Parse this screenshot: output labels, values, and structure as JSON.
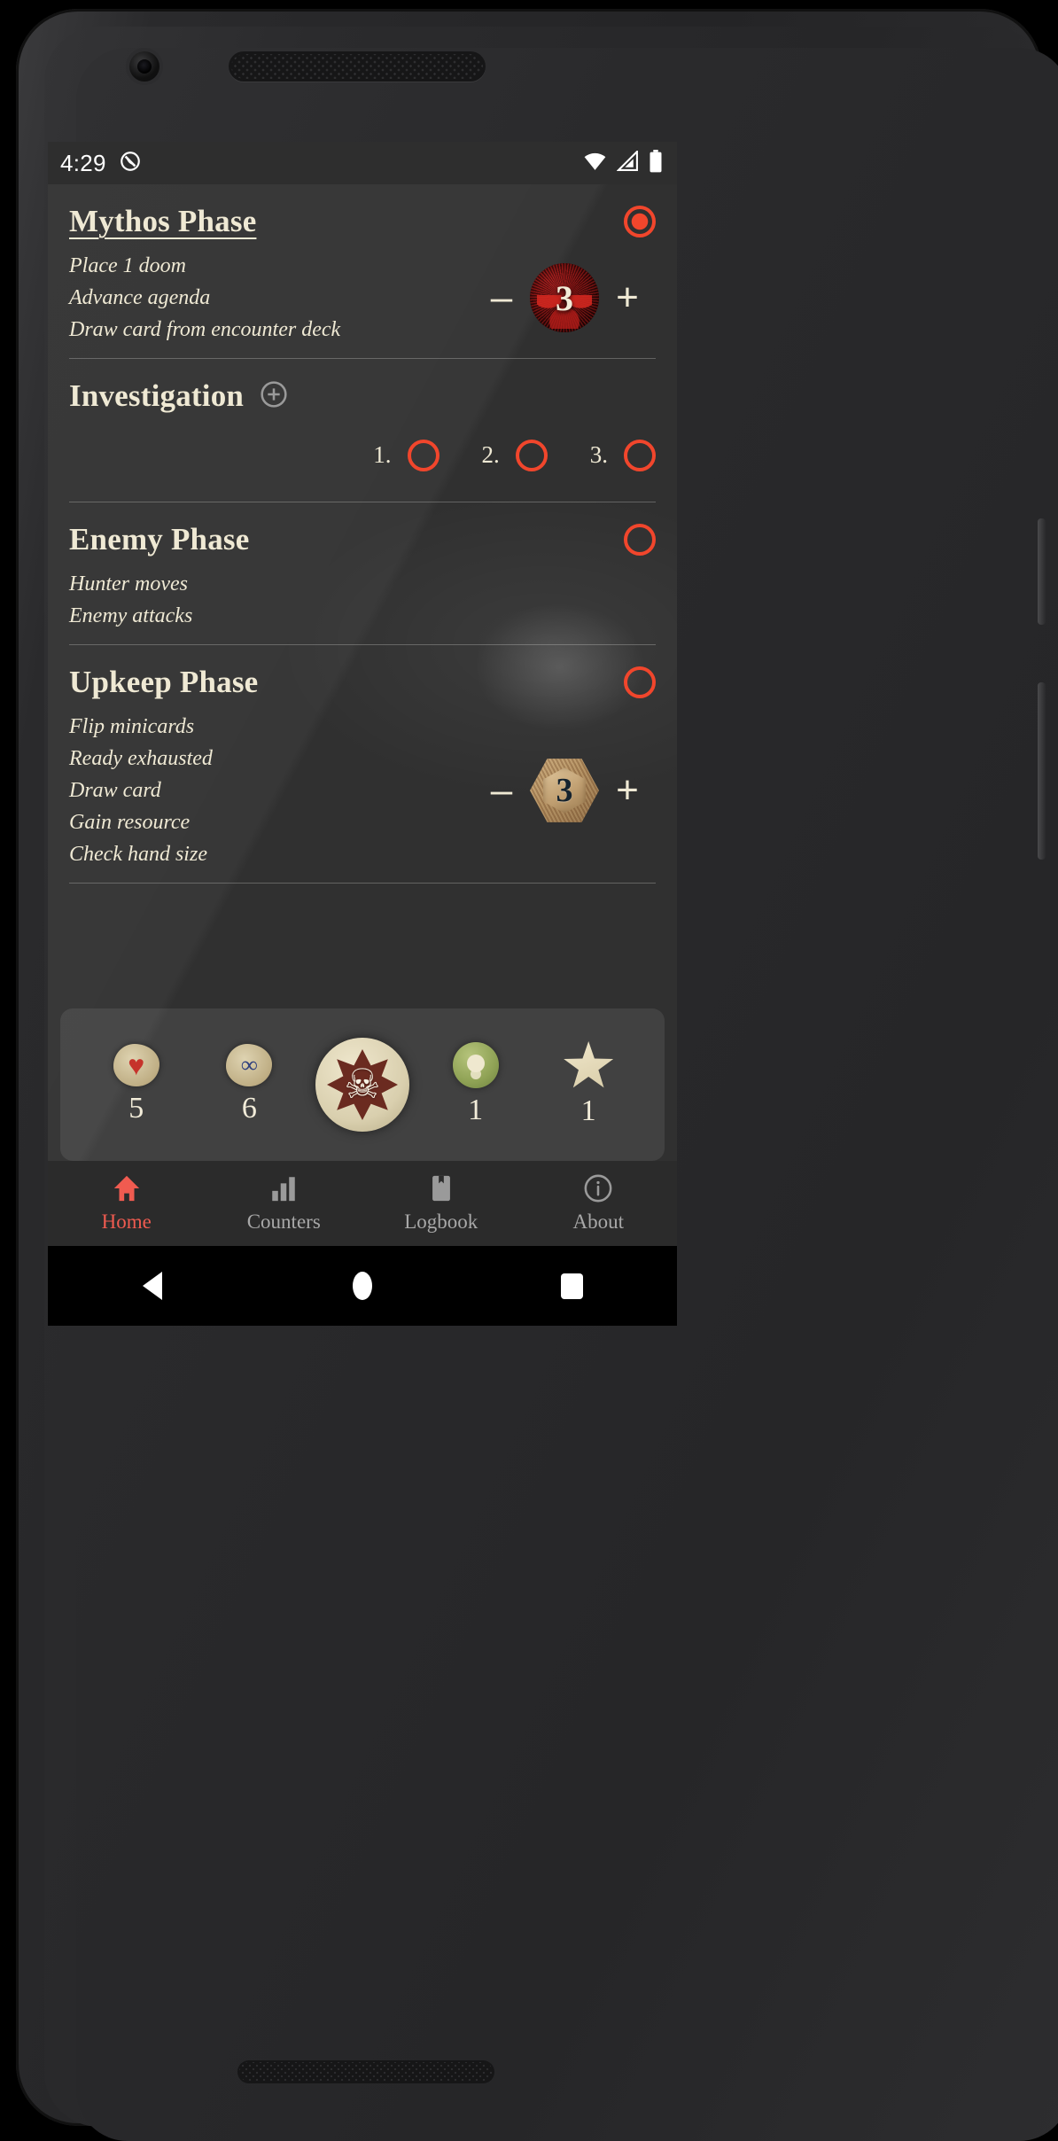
{
  "status_bar": {
    "time": "4:29",
    "icons": [
      "do-not-disturb-icon",
      "wifi-icon",
      "cellular-signal-icon",
      "battery-icon"
    ]
  },
  "colors": {
    "accent_red": "#f1462c",
    "nav_active": "#f05b50",
    "parchment": "#efe9d4",
    "screen_bg": "#303030",
    "tray_bg": "rgba(255,255,255,0.085)"
  },
  "phases": [
    {
      "title": "Mythos Phase",
      "underlined": true,
      "selected": true,
      "bullets": [
        "Place 1 doom",
        "Advance agenda",
        "Draw card from encounter deck"
      ],
      "counter": {
        "type": "doom-token",
        "value": "3",
        "decrement_label": "–",
        "increment_label": "+"
      }
    },
    {
      "title": "Enemy Phase",
      "underlined": false,
      "selected": false,
      "bullets": [
        "Hunter moves",
        "Enemy attacks"
      ],
      "counter": null
    },
    {
      "title": "Upkeep Phase",
      "underlined": false,
      "selected": false,
      "bullets": [
        "Flip minicards",
        "Ready exhausted",
        "Draw card",
        "Gain resource",
        "Check hand size"
      ],
      "counter": {
        "type": "resource-token",
        "value": "3",
        "decrement_label": "–",
        "increment_label": "+"
      }
    }
  ],
  "investigation": {
    "title": "Investigation",
    "add_icon": "add-circle-icon",
    "slots": [
      {
        "number": "1.",
        "selected": false
      },
      {
        "number": "2.",
        "selected": false
      },
      {
        "number": "3.",
        "selected": false
      }
    ]
  },
  "counter_tray": [
    {
      "icon": "health-token-icon",
      "glyph": "♥",
      "value": "5"
    },
    {
      "icon": "sanity-token-icon",
      "glyph": "∞",
      "value": "6"
    },
    {
      "icon": "skull-token-icon",
      "glyph": "☠",
      "value": ""
    },
    {
      "icon": "clue-token-icon",
      "glyph": "",
      "value": "1"
    },
    {
      "icon": "star-token-icon",
      "glyph": "",
      "value": "1"
    }
  ],
  "bottom_nav": [
    {
      "label": "Home",
      "icon": "home-icon",
      "active": true
    },
    {
      "label": "Counters",
      "icon": "bar-chart-icon",
      "active": false
    },
    {
      "label": "Logbook",
      "icon": "bookmark-icon",
      "active": false
    },
    {
      "label": "About",
      "icon": "info-circle-icon",
      "active": false
    }
  ],
  "android_nav": [
    {
      "name": "back-button"
    },
    {
      "name": "home-button"
    },
    {
      "name": "recents-button"
    }
  ]
}
